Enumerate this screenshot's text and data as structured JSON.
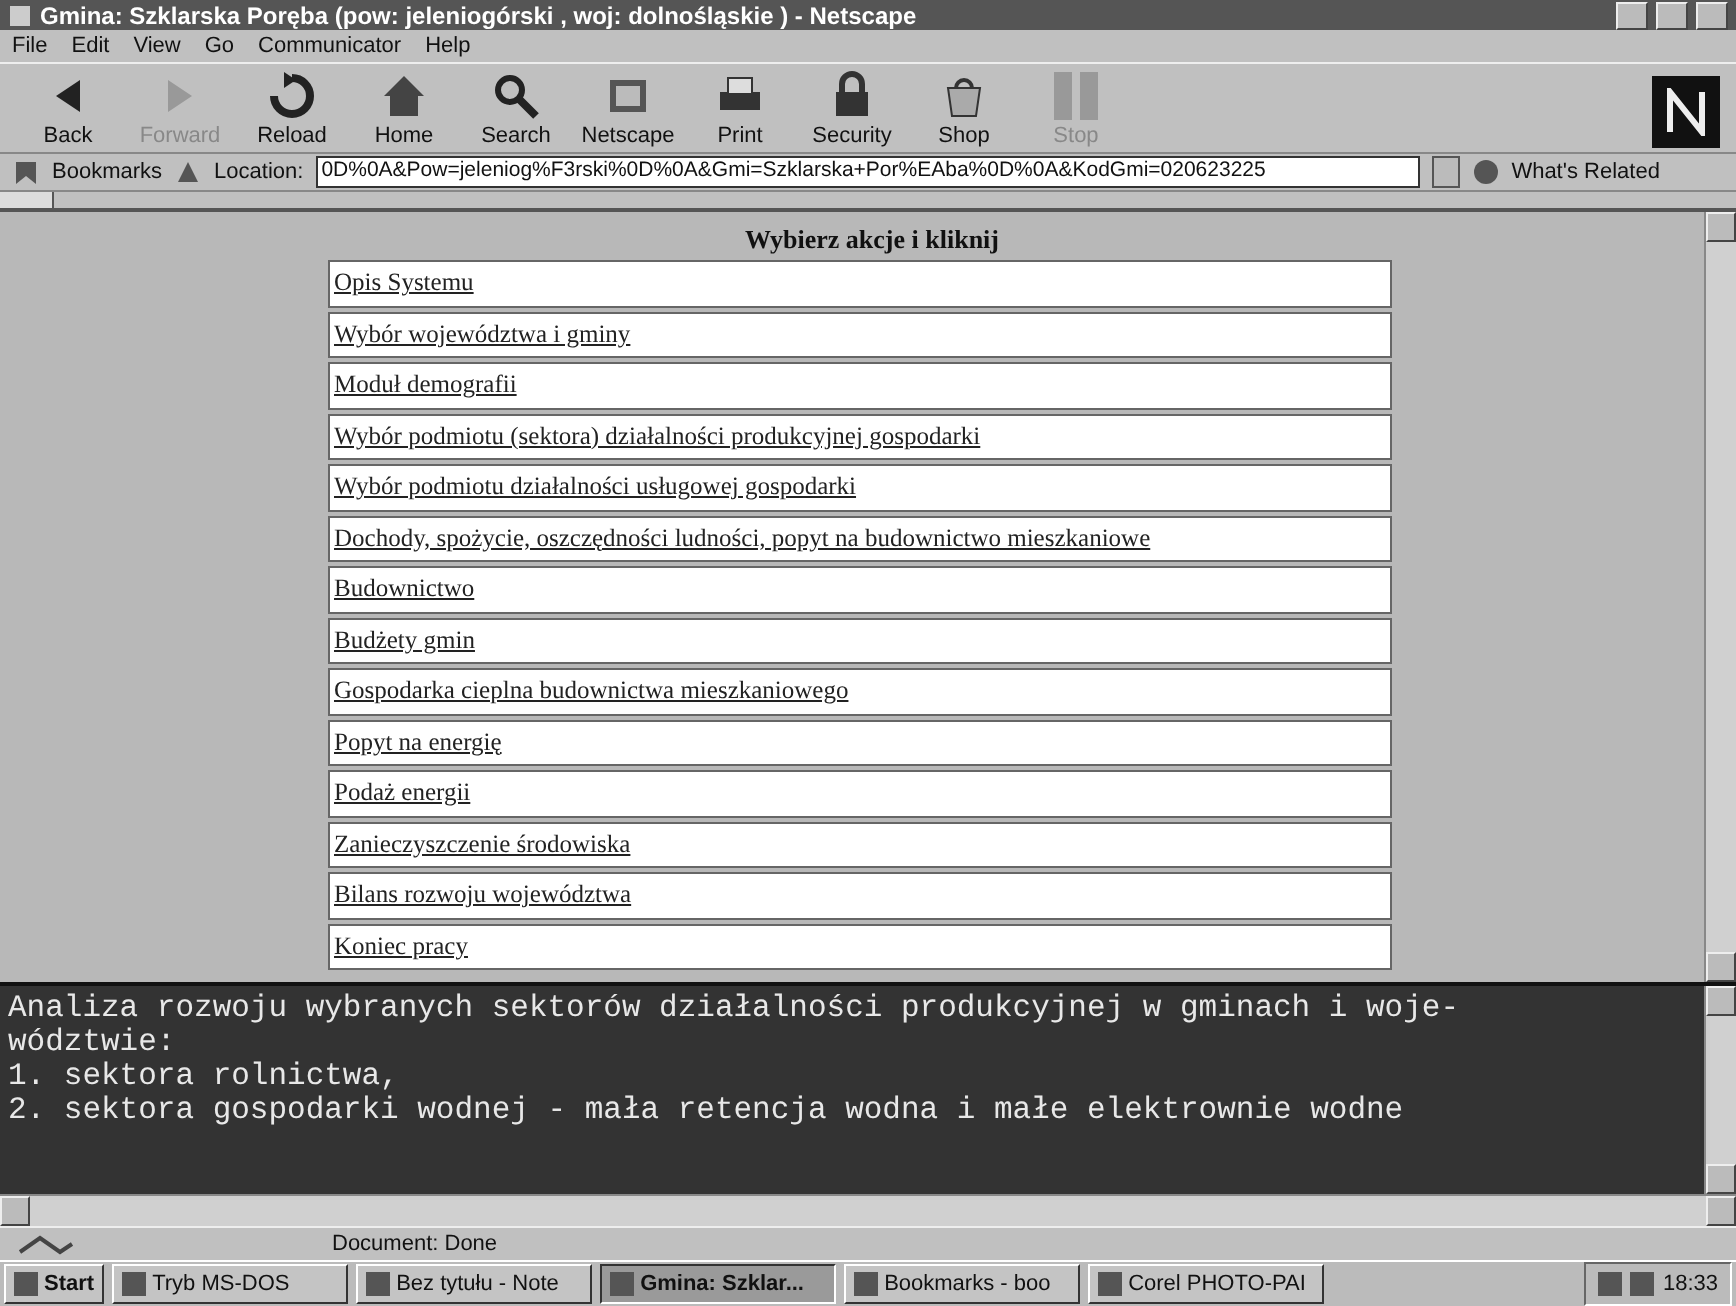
{
  "window": {
    "title": "Gmina: Szklarska Poręba (pow: jeleniogórski , woj: dolnośląskie ) - Netscape"
  },
  "menu": [
    "File",
    "Edit",
    "View",
    "Go",
    "Communicator",
    "Help"
  ],
  "toolbar": [
    {
      "label": "Back",
      "kind": "back",
      "disabled": false
    },
    {
      "label": "Forward",
      "kind": "forward",
      "disabled": true
    },
    {
      "label": "Reload",
      "kind": "reload",
      "disabled": false
    },
    {
      "label": "Home",
      "kind": "home",
      "disabled": false
    },
    {
      "label": "Search",
      "kind": "search",
      "disabled": false
    },
    {
      "label": "Netscape",
      "kind": "netscape",
      "disabled": false
    },
    {
      "label": "Print",
      "kind": "print",
      "disabled": false
    },
    {
      "label": "Security",
      "kind": "security",
      "disabled": false
    },
    {
      "label": "Shop",
      "kind": "shop",
      "disabled": false
    },
    {
      "label": "Stop",
      "kind": "stop",
      "disabled": true
    }
  ],
  "location_bar": {
    "bookmarks": "Bookmarks",
    "location_label": "Location:",
    "url": "0D%0A&Pow=jeleniog%F3rski%0D%0A&Gmi=Szklarska+Por%EAba%0D%0A&KodGmi=020623225",
    "whats_related": "What's Related"
  },
  "page": {
    "heading": "Wybierz akcje i kliknij",
    "links": [
      "Opis Systemu",
      "Wybór województwa i gminy",
      "Moduł demografii",
      "Wybór podmiotu (sektora) działalności produkcyjnej gospodarki",
      "Wybór podmiotu działalności usługowej gospodarki",
      "Dochody, spożycie, oszczędności ludności, popyt na budownictwo mieszkaniowe",
      "Budownictwo",
      "Budżety gmin",
      "Gospodarka cieplna budownictwa mieszkaniowego",
      "Popyt na energię",
      "Podaż energii",
      "Zanieczyszczenie środowiska",
      "Bilans rozwoju województwa",
      "Koniec pracy"
    ]
  },
  "description": {
    "lines": [
      "Analiza rozwoju wybranych sektorów działalności produkcyjnej w gminach i woje-",
      "wództwie:",
      "1. sektora rolnictwa,",
      "2. sektora gospodarki wodnej - mała retencja wodna i małe elektrownie wodne"
    ]
  },
  "status_bar": {
    "text": "Document: Done"
  },
  "taskbar": {
    "start": "Start",
    "tasks": [
      {
        "label": "Tryb MS-DOS",
        "selected": false
      },
      {
        "label": "Bez tytułu - Note",
        "selected": false
      },
      {
        "label": "Gmina: Szklar...",
        "selected": true
      },
      {
        "label": "Bookmarks - boo",
        "selected": false
      },
      {
        "label": "Corel PHOTO-PAI",
        "selected": false
      }
    ],
    "clock": "18:33"
  }
}
